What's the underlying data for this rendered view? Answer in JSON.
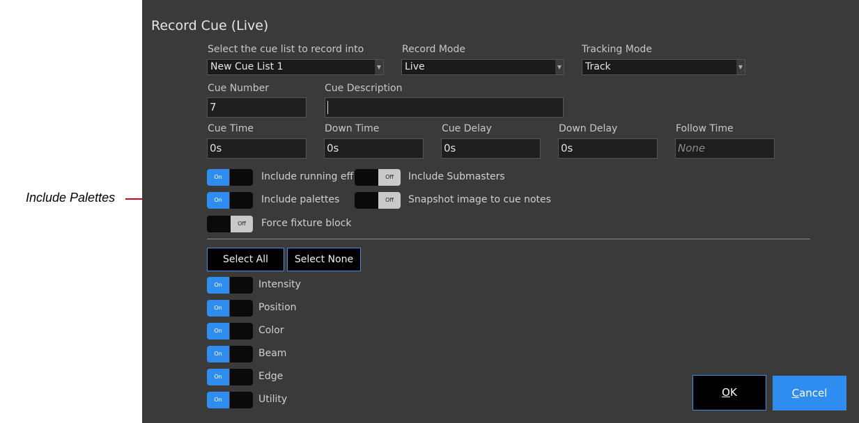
{
  "annotation": {
    "label": "Include Palettes"
  },
  "dialog": {
    "title": "Record Cue (Live)",
    "cue_list": {
      "label": "Select the cue list to record into",
      "value": "New Cue List 1"
    },
    "record_mode": {
      "label": "Record Mode",
      "value": "Live"
    },
    "tracking_mode": {
      "label": "Tracking Mode",
      "value": "Track"
    },
    "cue_number": {
      "label": "Cue Number",
      "value": "7"
    },
    "cue_description": {
      "label": "Cue Description",
      "value": ""
    },
    "cue_time": {
      "label": "Cue Time",
      "value": "0s"
    },
    "down_time": {
      "label": "Down Time",
      "value": "0s"
    },
    "cue_delay": {
      "label": "Cue Delay",
      "value": "0s"
    },
    "down_delay": {
      "label": "Down Delay",
      "value": "0s"
    },
    "follow_time": {
      "label": "Follow Time",
      "placeholder": "None"
    },
    "options": {
      "include_running_effects": {
        "label": "Include running eff",
        "state": "On"
      },
      "include_submasters": {
        "label": "Include Submasters",
        "state": "Off"
      },
      "include_palettes": {
        "label": "Include palettes",
        "state": "On"
      },
      "snapshot_image": {
        "label": "Snapshot image to cue notes",
        "state": "Off"
      },
      "force_fixture_block": {
        "label": "Force fixture block",
        "state": "Off"
      }
    },
    "select_all": "Select All",
    "select_none": "Select None",
    "attributes": [
      {
        "label": "Intensity",
        "state": "On"
      },
      {
        "label": "Position",
        "state": "On"
      },
      {
        "label": "Color",
        "state": "On"
      },
      {
        "label": "Beam",
        "state": "On"
      },
      {
        "label": "Edge",
        "state": "On"
      },
      {
        "label": "Utility",
        "state": "On"
      }
    ],
    "ok": {
      "mnemonic": "O",
      "rest": "K"
    },
    "cancel": {
      "mnemonic": "C",
      "rest": "ancel"
    }
  },
  "colors": {
    "dialog_bg": "#3a3a3a",
    "accent_blue": "#2f8df0",
    "annotation_line": "#d0021b"
  }
}
